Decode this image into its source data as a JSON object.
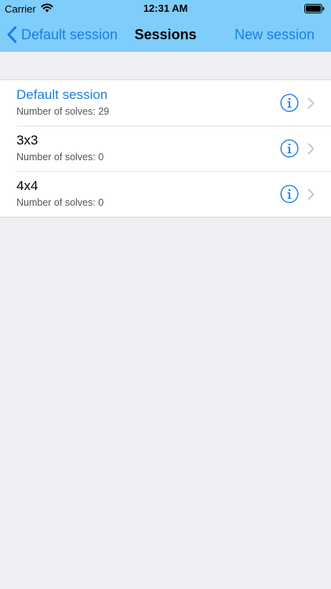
{
  "status_bar": {
    "carrier": "Carrier",
    "time": "12:31 AM"
  },
  "nav": {
    "back_label": "Default session",
    "title": "Sessions",
    "new_label": "New session"
  },
  "sessions": [
    {
      "name": "Default session",
      "subtitle": "Number of solves: 29",
      "active": true
    },
    {
      "name": "3x3",
      "subtitle": "Number of solves: 0",
      "active": false
    },
    {
      "name": "4x4",
      "subtitle": "Number of solves: 0",
      "active": false
    }
  ],
  "colors": {
    "header_bg": "#7fcdfb",
    "accent": "#1a7fe6",
    "page_bg": "#efeff4"
  },
  "icons": {
    "back": "chevron-left-icon",
    "info": "info-circle-icon",
    "disclosure": "chevron-right-icon",
    "wifi": "wifi-icon",
    "battery": "battery-icon"
  }
}
